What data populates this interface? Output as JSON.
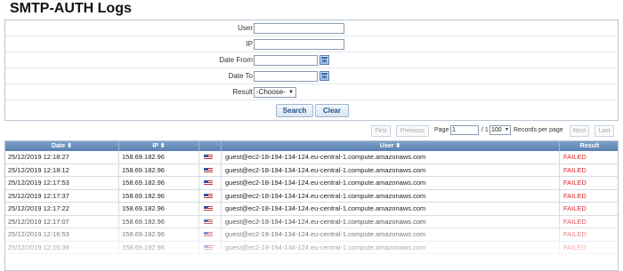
{
  "page": {
    "title": "SMTP-AUTH Logs"
  },
  "filters": {
    "user_label": "User",
    "ip_label": "IP",
    "date_from_label": "Date From",
    "date_to_label": "Date To",
    "result_label": "Result",
    "result_value": "-Choose-",
    "search_label": "Search",
    "clear_label": "Clear"
  },
  "pager": {
    "first": "First",
    "previous": "Previous",
    "page_label": "Page",
    "page_value": "1",
    "of_text": "/ 1",
    "per_page_value": "100",
    "per_page_label": "Records per page",
    "next": "Next",
    "last": "Last"
  },
  "table": {
    "columns": [
      "Date",
      "IP",
      "",
      "User",
      "Result"
    ],
    "sort_icon": "sort-icon",
    "rows": [
      {
        "date": "25/12/2019 12:18:27",
        "ip": "158.69.182.96",
        "flag": "us-flag-icon",
        "user": "guest@ec2-18-194-134-124.eu-central-1.compute.amazonaws.com",
        "result": "FAILED"
      },
      {
        "date": "25/12/2019 12:18:12",
        "ip": "158.69.182.96",
        "flag": "us-flag-icon",
        "user": "guest@ec2-18-194-134-124.eu-central-1.compute.amazonaws.com",
        "result": "FAILED"
      },
      {
        "date": "25/12/2019 12:17:53",
        "ip": "158.69.182.96",
        "flag": "us-flag-icon",
        "user": "guest@ec2-18-194-134-124.eu-central-1.compute.amazonaws.com",
        "result": "FAILED"
      },
      {
        "date": "25/12/2019 12:17:37",
        "ip": "158.69.182.96",
        "flag": "us-flag-icon",
        "user": "guest@ec2-18-194-134-124.eu-central-1.compute.amazonaws.com",
        "result": "FAILED"
      },
      {
        "date": "25/12/2019 12:17:22",
        "ip": "158.69.182.96",
        "flag": "us-flag-icon",
        "user": "guest@ec2-18-194-134-124.eu-central-1.compute.amazonaws.com",
        "result": "FAILED"
      },
      {
        "date": "25/12/2019 12:17:07",
        "ip": "158.69.182.96",
        "flag": "us-flag-icon",
        "user": "guest@ec2-18-194-134-124.eu-central-1.compute.amazonaws.com",
        "result": "FAILED"
      },
      {
        "date": "25/12/2019 12:16:53",
        "ip": "158.69.182.96",
        "flag": "us-flag-icon",
        "user": "guest@ec2-18-194-134-124.eu-central-1.compute.amazonaws.com",
        "result": "FAILED"
      },
      {
        "date": "25/12/2019 12:16:39",
        "ip": "158.69.182.96",
        "flag": "us-flag-icon",
        "user": "guest@ec2-18-194-134-124.eu-central-1.compute.amazonaws.com",
        "result": "FAILED"
      }
    ]
  },
  "colors": {
    "header_bg": "#5a80b0",
    "failed": "#d9262b",
    "accent": "#1d4f8e"
  }
}
